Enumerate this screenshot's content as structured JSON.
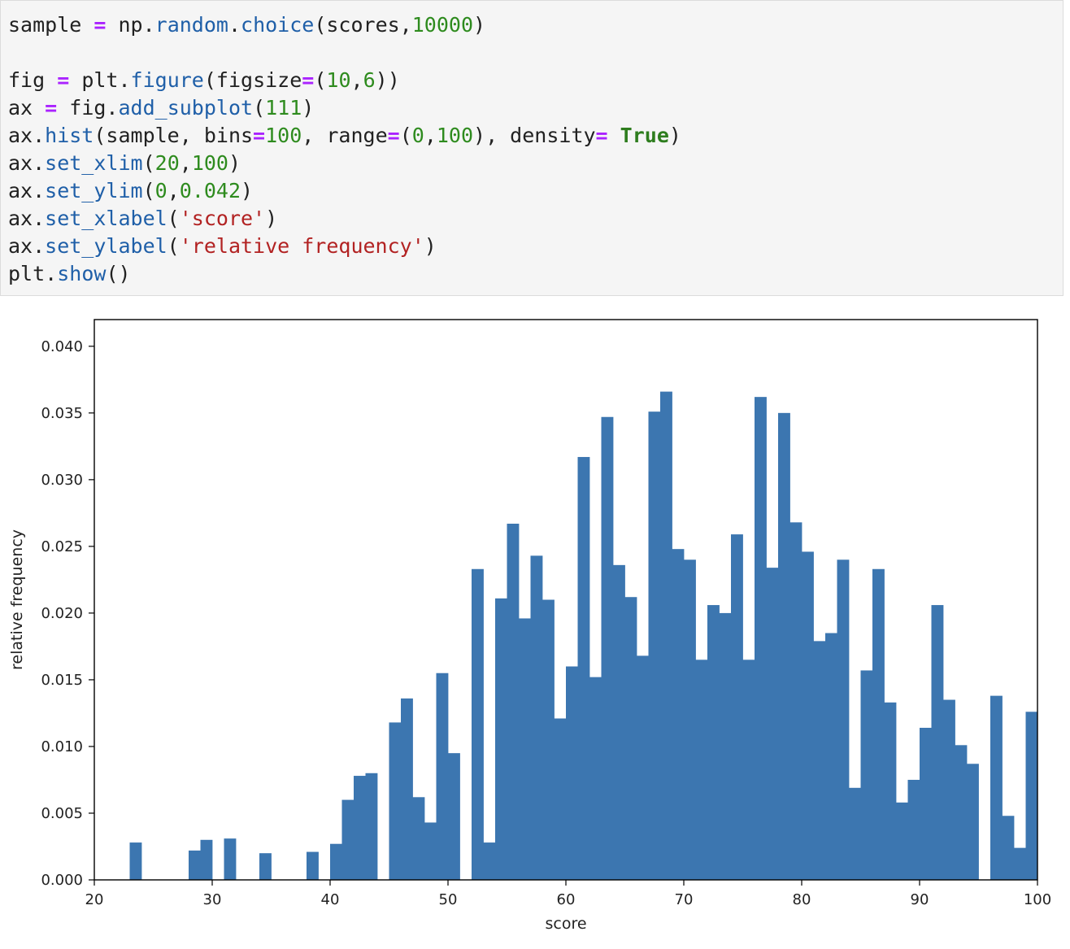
{
  "code_cell": {
    "lines": [
      [
        {
          "t": "sample ",
          "c": "plain"
        },
        {
          "t": "=",
          "c": "op"
        },
        {
          "t": " np.",
          "c": "plain"
        },
        {
          "t": "random",
          "c": "attr"
        },
        {
          "t": ".",
          "c": "plain"
        },
        {
          "t": "choice",
          "c": "attr"
        },
        {
          "t": "(scores,",
          "c": "plain"
        },
        {
          "t": "10000",
          "c": "num"
        },
        {
          "t": ")",
          "c": "plain"
        }
      ],
      [],
      [
        {
          "t": "fig ",
          "c": "plain"
        },
        {
          "t": "=",
          "c": "op"
        },
        {
          "t": " plt.",
          "c": "plain"
        },
        {
          "t": "figure",
          "c": "attr"
        },
        {
          "t": "(figsize",
          "c": "plain"
        },
        {
          "t": "=",
          "c": "op"
        },
        {
          "t": "(",
          "c": "plain"
        },
        {
          "t": "10",
          "c": "num"
        },
        {
          "t": ",",
          "c": "plain"
        },
        {
          "t": "6",
          "c": "num"
        },
        {
          "t": "))",
          "c": "plain"
        }
      ],
      [
        {
          "t": "ax ",
          "c": "plain"
        },
        {
          "t": "=",
          "c": "op"
        },
        {
          "t": " fig.",
          "c": "plain"
        },
        {
          "t": "add_subplot",
          "c": "attr"
        },
        {
          "t": "(",
          "c": "plain"
        },
        {
          "t": "111",
          "c": "num"
        },
        {
          "t": ")",
          "c": "plain"
        }
      ],
      [
        {
          "t": "ax.",
          "c": "plain"
        },
        {
          "t": "hist",
          "c": "attr"
        },
        {
          "t": "(sample, bins",
          "c": "plain"
        },
        {
          "t": "=",
          "c": "op"
        },
        {
          "t": "100",
          "c": "num"
        },
        {
          "t": ", range",
          "c": "plain"
        },
        {
          "t": "=",
          "c": "op"
        },
        {
          "t": "(",
          "c": "plain"
        },
        {
          "t": "0",
          "c": "num"
        },
        {
          "t": ",",
          "c": "plain"
        },
        {
          "t": "100",
          "c": "num"
        },
        {
          "t": "), density",
          "c": "plain"
        },
        {
          "t": "=",
          "c": "op"
        },
        {
          "t": " ",
          "c": "plain"
        },
        {
          "t": "True",
          "c": "kw"
        },
        {
          "t": ")",
          "c": "plain"
        }
      ],
      [
        {
          "t": "ax.",
          "c": "plain"
        },
        {
          "t": "set_xlim",
          "c": "attr"
        },
        {
          "t": "(",
          "c": "plain"
        },
        {
          "t": "20",
          "c": "num"
        },
        {
          "t": ",",
          "c": "plain"
        },
        {
          "t": "100",
          "c": "num"
        },
        {
          "t": ")",
          "c": "plain"
        }
      ],
      [
        {
          "t": "ax.",
          "c": "plain"
        },
        {
          "t": "set_ylim",
          "c": "attr"
        },
        {
          "t": "(",
          "c": "plain"
        },
        {
          "t": "0",
          "c": "num"
        },
        {
          "t": ",",
          "c": "plain"
        },
        {
          "t": "0.042",
          "c": "num"
        },
        {
          "t": ")",
          "c": "plain"
        }
      ],
      [
        {
          "t": "ax.",
          "c": "plain"
        },
        {
          "t": "set_xlabel",
          "c": "attr"
        },
        {
          "t": "(",
          "c": "plain"
        },
        {
          "t": "'score'",
          "c": "str"
        },
        {
          "t": ")",
          "c": "plain"
        }
      ],
      [
        {
          "t": "ax.",
          "c": "plain"
        },
        {
          "t": "set_ylabel",
          "c": "attr"
        },
        {
          "t": "(",
          "c": "plain"
        },
        {
          "t": "'relative frequency'",
          "c": "str"
        },
        {
          "t": ")",
          "c": "plain"
        }
      ],
      [
        {
          "t": "plt.",
          "c": "plain"
        },
        {
          "t": "show",
          "c": "attr"
        },
        {
          "t": "()",
          "c": "plain"
        }
      ]
    ]
  },
  "chart_data": {
    "type": "bar",
    "bin_width": 1,
    "xlim": [
      20,
      100
    ],
    "ylim": [
      0,
      0.042
    ],
    "xlabel": "score",
    "ylabel": "relative frequency",
    "xticks": [
      "20",
      "30",
      "40",
      "50",
      "60",
      "70",
      "80",
      "90",
      "100"
    ],
    "yticks": [
      "0.000",
      "0.005",
      "0.010",
      "0.015",
      "0.020",
      "0.025",
      "0.030",
      "0.035",
      "0.040"
    ],
    "bar_color": "#3c76b0",
    "bins": [
      {
        "x": 23,
        "y": 0.0028
      },
      {
        "x": 28,
        "y": 0.0022
      },
      {
        "x": 29,
        "y": 0.003
      },
      {
        "x": 31,
        "y": 0.0031
      },
      {
        "x": 34,
        "y": 0.002
      },
      {
        "x": 38,
        "y": 0.0021
      },
      {
        "x": 40,
        "y": 0.0027
      },
      {
        "x": 41,
        "y": 0.006
      },
      {
        "x": 42,
        "y": 0.0078
      },
      {
        "x": 43,
        "y": 0.008
      },
      {
        "x": 45,
        "y": 0.0118
      },
      {
        "x": 46,
        "y": 0.0136
      },
      {
        "x": 47,
        "y": 0.0062
      },
      {
        "x": 48,
        "y": 0.0043
      },
      {
        "x": 49,
        "y": 0.0155
      },
      {
        "x": 50,
        "y": 0.0095
      },
      {
        "x": 52,
        "y": 0.0233
      },
      {
        "x": 53,
        "y": 0.0028
      },
      {
        "x": 54,
        "y": 0.0211
      },
      {
        "x": 55,
        "y": 0.0267
      },
      {
        "x": 56,
        "y": 0.0196
      },
      {
        "x": 57,
        "y": 0.0243
      },
      {
        "x": 58,
        "y": 0.021
      },
      {
        "x": 59,
        "y": 0.0121
      },
      {
        "x": 60,
        "y": 0.016
      },
      {
        "x": 61,
        "y": 0.0317
      },
      {
        "x": 62,
        "y": 0.0152
      },
      {
        "x": 63,
        "y": 0.0347
      },
      {
        "x": 64,
        "y": 0.0236
      },
      {
        "x": 65,
        "y": 0.0212
      },
      {
        "x": 66,
        "y": 0.0168
      },
      {
        "x": 67,
        "y": 0.0351
      },
      {
        "x": 68,
        "y": 0.0366
      },
      {
        "x": 69,
        "y": 0.0248
      },
      {
        "x": 70,
        "y": 0.024
      },
      {
        "x": 71,
        "y": 0.0165
      },
      {
        "x": 72,
        "y": 0.0206
      },
      {
        "x": 73,
        "y": 0.02
      },
      {
        "x": 74,
        "y": 0.0259
      },
      {
        "x": 75,
        "y": 0.0165
      },
      {
        "x": 76,
        "y": 0.0362
      },
      {
        "x": 77,
        "y": 0.0234
      },
      {
        "x": 78,
        "y": 0.035
      },
      {
        "x": 79,
        "y": 0.0268
      },
      {
        "x": 80,
        "y": 0.0246
      },
      {
        "x": 81,
        "y": 0.0179
      },
      {
        "x": 82,
        "y": 0.0185
      },
      {
        "x": 83,
        "y": 0.024
      },
      {
        "x": 84,
        "y": 0.0069
      },
      {
        "x": 85,
        "y": 0.0157
      },
      {
        "x": 86,
        "y": 0.0233
      },
      {
        "x": 87,
        "y": 0.0133
      },
      {
        "x": 88,
        "y": 0.0058
      },
      {
        "x": 89,
        "y": 0.0075
      },
      {
        "x": 90,
        "y": 0.0114
      },
      {
        "x": 91,
        "y": 0.0206
      },
      {
        "x": 92,
        "y": 0.0135
      },
      {
        "x": 93,
        "y": 0.0101
      },
      {
        "x": 94,
        "y": 0.0087
      },
      {
        "x": 96,
        "y": 0.0138
      },
      {
        "x": 97,
        "y": 0.0048
      },
      {
        "x": 98,
        "y": 0.0024
      },
      {
        "x": 99,
        "y": 0.0126
      }
    ]
  }
}
